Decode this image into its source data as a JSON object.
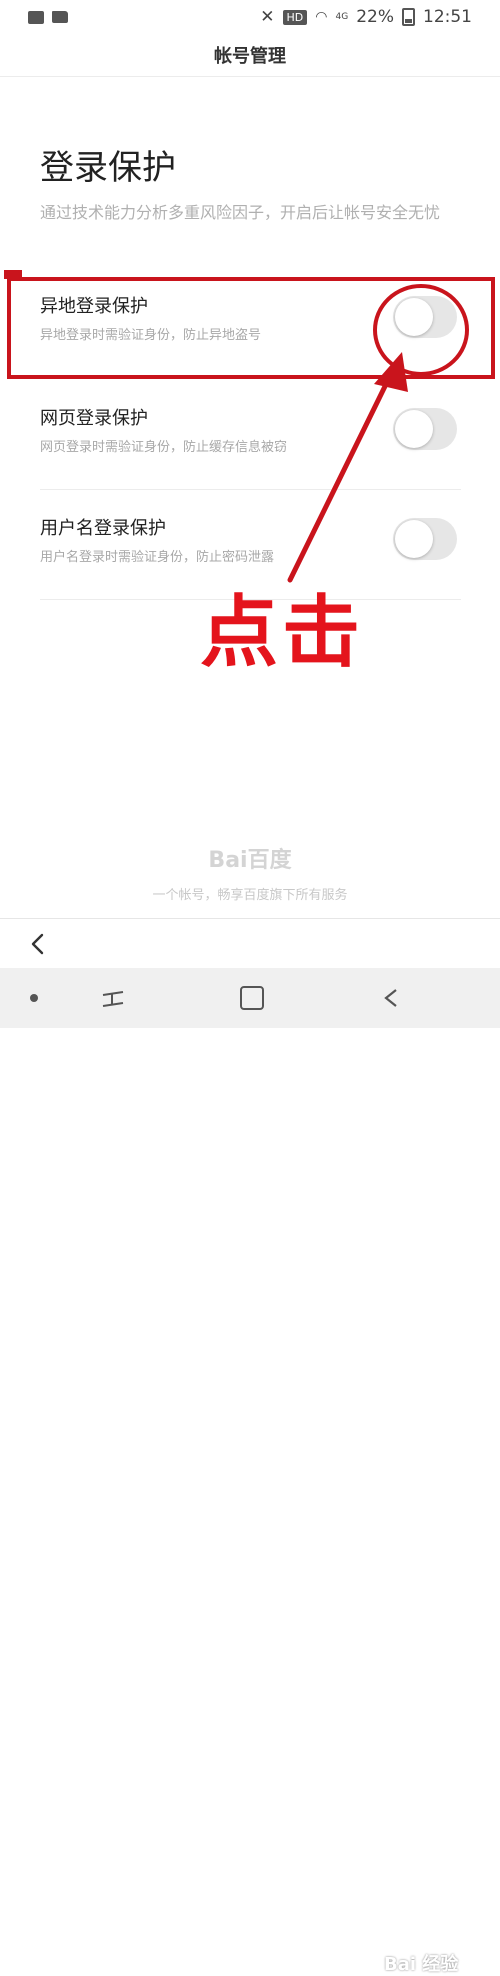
{
  "status_bar": {
    "hd": "HD",
    "signal": "4G",
    "battery": "22%",
    "time": "12:51"
  },
  "title_bar": {
    "title": "帐号管理"
  },
  "section": {
    "heading": "登录保护",
    "description": "通过技术能力分析多重风险因子，开启后让帐号安全无忧"
  },
  "settings": [
    {
      "title": "异地登录保护",
      "subtitle": "异地登录时需验证身份，防止异地盗号",
      "enabled": false
    },
    {
      "title": "网页登录保护",
      "subtitle": "网页登录时需验证身份，防止缓存信息被窃",
      "enabled": false
    },
    {
      "title": "用户名登录保护",
      "subtitle": "用户名登录时需验证身份，防止密码泄露",
      "enabled": false
    }
  ],
  "annotation": {
    "text": "点击",
    "color": "#e4141c"
  },
  "footer": {
    "logo": "Bai百度",
    "slogan": "一个帐号，畅享百度旗下所有服务"
  },
  "watermark": {
    "text": "Bai 经验"
  },
  "icons": {
    "back": "chevron-left-icon",
    "mute": "mute-icon",
    "wifi": "wifi-icon",
    "battery": "battery-icon"
  }
}
